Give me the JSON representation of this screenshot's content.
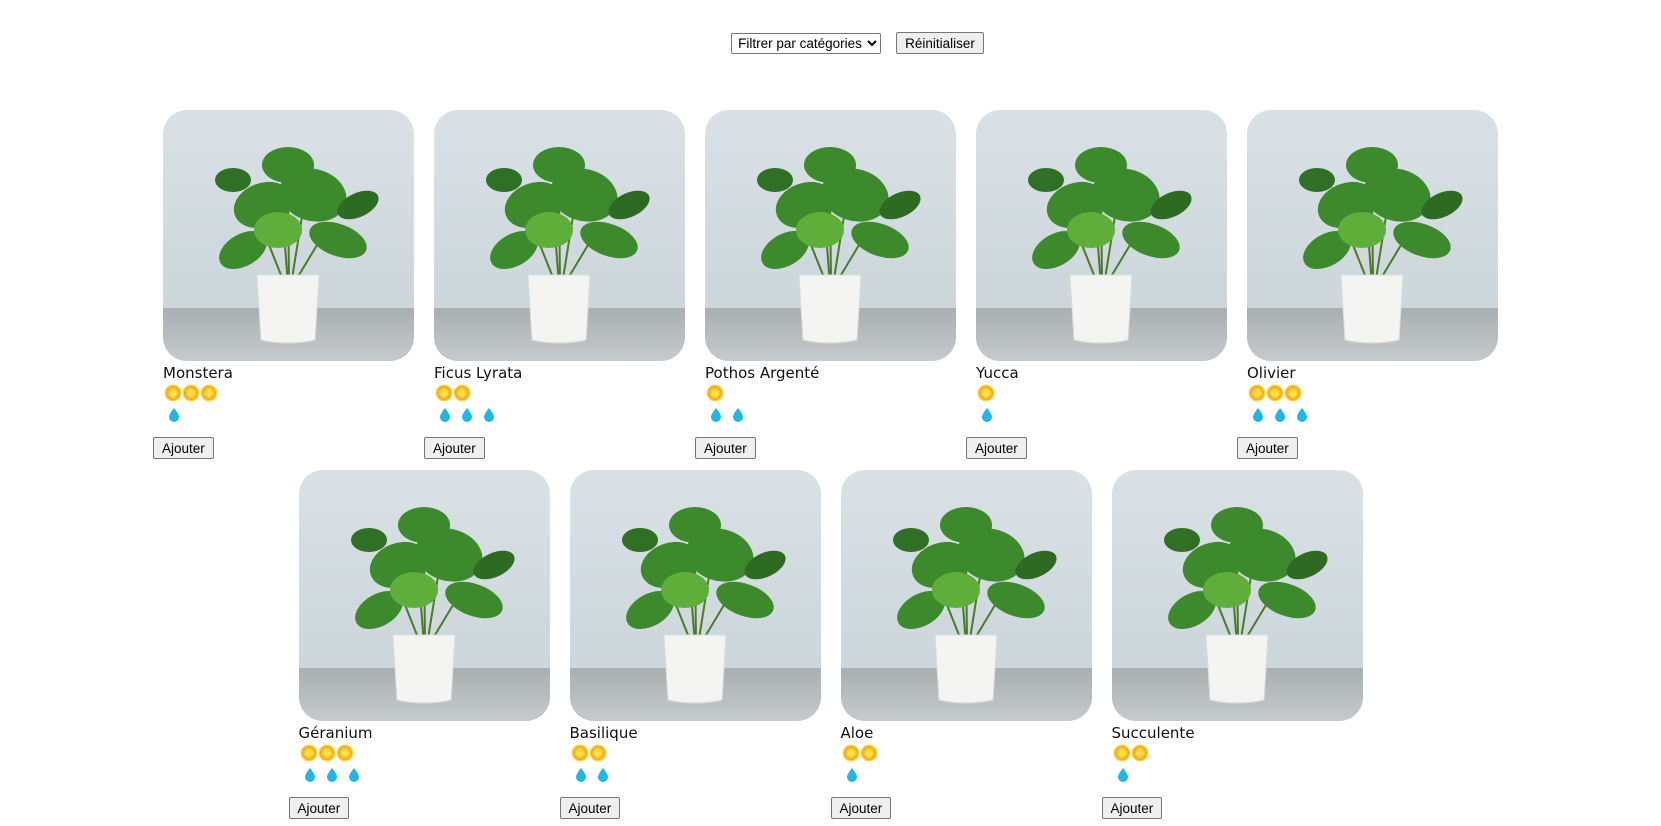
{
  "toolbar": {
    "filter_label": "Filtrer par catégories",
    "reset_label": "Réinitialiser"
  },
  "colors": {
    "sun": "#fbbf24",
    "water": "#1fb6e8",
    "wall": "#d7dfe3",
    "leaf": "#3d8a2c"
  },
  "add_label": "Ajouter",
  "plants": [
    {
      "name": "Monstera",
      "light": 3,
      "water": 1
    },
    {
      "name": "Ficus Lyrata",
      "light": 2,
      "water": 3
    },
    {
      "name": "Pothos Argenté",
      "light": 1,
      "water": 2
    },
    {
      "name": "Yucca",
      "light": 1,
      "water": 1
    },
    {
      "name": "Olivier",
      "light": 3,
      "water": 3
    },
    {
      "name": "Géranium",
      "light": 3,
      "water": 3
    },
    {
      "name": "Basilique",
      "light": 2,
      "water": 2
    },
    {
      "name": "Aloe",
      "light": 2,
      "water": 1
    },
    {
      "name": "Succulente",
      "light": 2,
      "water": 1
    }
  ]
}
